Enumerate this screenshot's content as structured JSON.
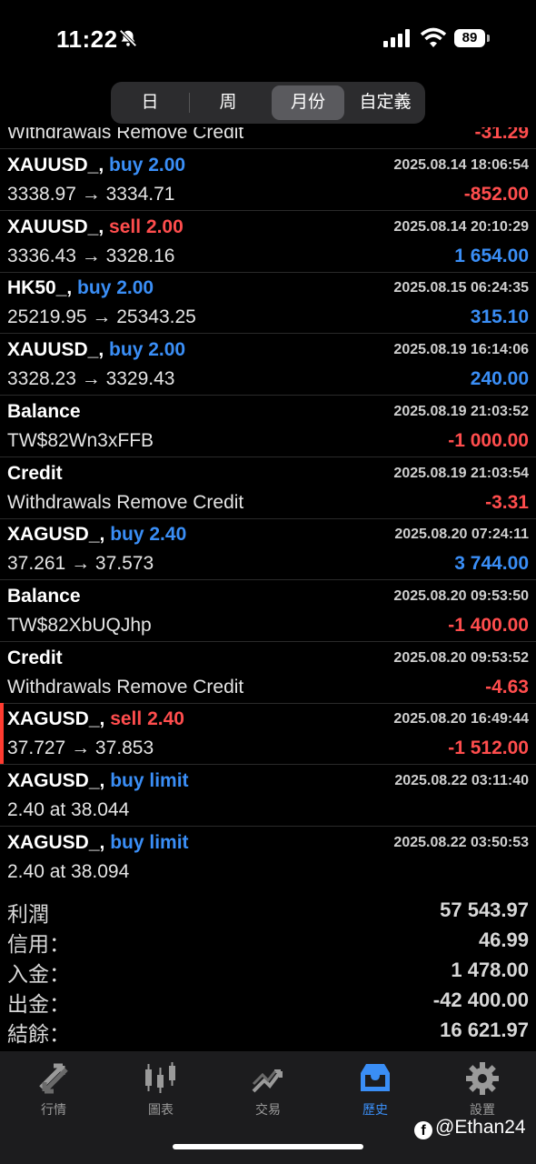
{
  "status": {
    "time": "11:22",
    "battery": "89"
  },
  "segments": [
    "日",
    "周",
    "月份",
    "自定義"
  ],
  "active_segment": "月份",
  "partial_row": {
    "l2": "Withdrawals Remove Credit",
    "amount": "-31.29"
  },
  "rows": [
    {
      "symbol": "XAUUSD_,",
      "action": "buy 2.00",
      "side": "buy",
      "date": "2025.08.14 18:06:54",
      "detail": "3338.97 → 3334.71",
      "amount": "-852.00",
      "sign": "neg"
    },
    {
      "symbol": "XAUUSD_,",
      "action": "sell 2.00",
      "side": "sell",
      "date": "2025.08.14 20:10:29",
      "detail": "3336.43 → 3328.16",
      "amount": "1 654.00",
      "sign": "pos"
    },
    {
      "symbol": "HK50_,",
      "action": "buy 2.00",
      "side": "buy",
      "date": "2025.08.15 06:24:35",
      "detail": "25219.95 → 25343.25",
      "amount": "315.10",
      "sign": "pos"
    },
    {
      "symbol": "XAUUSD_,",
      "action": "buy 2.00",
      "side": "buy",
      "date": "2025.08.19 16:14:06",
      "detail": "3328.23 → 3329.43",
      "amount": "240.00",
      "sign": "pos"
    },
    {
      "symbol": "Balance",
      "action": "",
      "side": "",
      "date": "2025.08.19 21:03:52",
      "detail": "TW$82Wn3xFFB",
      "amount": "-1 000.00",
      "sign": "neg"
    },
    {
      "symbol": "Credit",
      "action": "",
      "side": "",
      "date": "2025.08.19 21:03:54",
      "detail": "Withdrawals Remove Credit",
      "amount": "-3.31",
      "sign": "neg"
    },
    {
      "symbol": "XAGUSD_,",
      "action": "buy 2.40",
      "side": "buy",
      "date": "2025.08.20 07:24:11",
      "detail": "37.261 → 37.573",
      "amount": "3 744.00",
      "sign": "pos"
    },
    {
      "symbol": "Balance",
      "action": "",
      "side": "",
      "date": "2025.08.20 09:53:50",
      "detail": "TW$82XbUQJhp",
      "amount": "-1 400.00",
      "sign": "neg"
    },
    {
      "symbol": "Credit",
      "action": "",
      "side": "",
      "date": "2025.08.20 09:53:52",
      "detail": "Withdrawals Remove Credit",
      "amount": "-4.63",
      "sign": "neg"
    },
    {
      "symbol": "XAGUSD_,",
      "action": "sell 2.40",
      "side": "sell",
      "date": "2025.08.20 16:49:44",
      "detail": "37.727 → 37.853",
      "amount": "-1 512.00",
      "sign": "neg",
      "selected": true
    },
    {
      "symbol": "XAGUSD_,",
      "action": "buy limit",
      "side": "buy",
      "date": "2025.08.22 03:11:40",
      "detail": "2.40 at 38.044",
      "amount": "",
      "sign": ""
    },
    {
      "symbol": "XAGUSD_,",
      "action": "buy limit",
      "side": "buy",
      "date": "2025.08.22 03:50:53",
      "detail": "2.40 at 38.094",
      "amount": "",
      "sign": ""
    }
  ],
  "summary": [
    {
      "label": "利潤",
      "value": "57 543.97"
    },
    {
      "label": "信用：",
      "value": "46.99"
    },
    {
      "label": "入金：",
      "value": "1 478.00"
    },
    {
      "label": "出金：",
      "value": "-42 400.00"
    },
    {
      "label": "結餘：",
      "value": "16 621.97"
    }
  ],
  "tabs": [
    {
      "label": "行情",
      "icon": "quotes-icon"
    },
    {
      "label": "圖表",
      "icon": "chart-icon"
    },
    {
      "label": "交易",
      "icon": "trade-icon"
    },
    {
      "label": "歷史",
      "icon": "history-icon"
    },
    {
      "label": "設置",
      "icon": "settings-icon"
    }
  ],
  "active_tab": "歷史",
  "watermark": "@Ethan24",
  "colors": {
    "buy": "#3a8ef6",
    "sell": "#ff4d4d",
    "accent": "#3a8ef6"
  }
}
